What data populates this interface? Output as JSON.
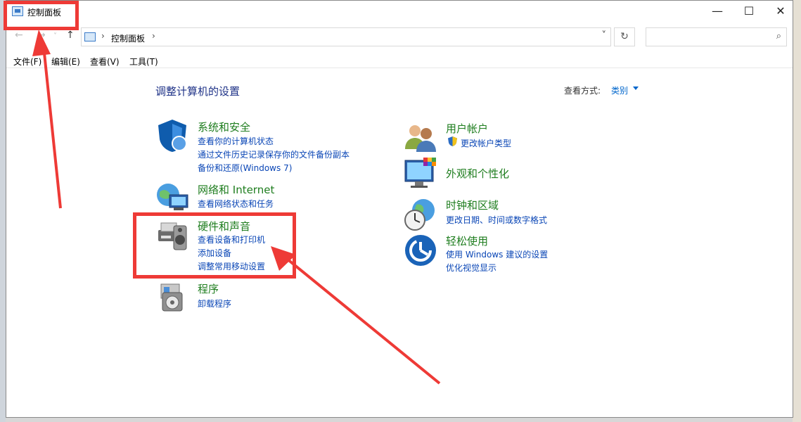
{
  "window": {
    "title": "控制面板",
    "minimize": "—",
    "maximize": "☐",
    "close": "✕"
  },
  "nav": {
    "back": "←",
    "forward": "→",
    "recent": "˅",
    "up": "↑",
    "address_sep": "›",
    "address": "控制面板",
    "address_dropdown": "˅",
    "refresh": "↻",
    "search_placeholder": "",
    "search_glyph": "⌕"
  },
  "menu": [
    "文件(F)",
    "编辑(E)",
    "查看(V)",
    "工具(T)"
  ],
  "heading": "调整计算机的设置",
  "view_by": {
    "label": "查看方式:",
    "value": "类别"
  },
  "categories": {
    "system": {
      "title": "系统和安全",
      "links": [
        "查看你的计算机状态",
        "通过文件历史记录保存你的文件备份副本",
        "备份和还原(Windows 7)"
      ]
    },
    "network": {
      "title": "网络和 Internet",
      "links": [
        "查看网络状态和任务"
      ]
    },
    "hardware": {
      "title": "硬件和声音",
      "links": [
        "查看设备和打印机",
        "添加设备",
        "调整常用移动设置"
      ]
    },
    "programs": {
      "title": "程序",
      "links": [
        "卸载程序"
      ]
    },
    "users": {
      "title": "用户帐户",
      "links": [
        "更改帐户类型"
      ]
    },
    "appearance": {
      "title": "外观和个性化",
      "links": []
    },
    "clock": {
      "title": "时钟和区域",
      "links": [
        "更改日期、时间或数字格式"
      ]
    },
    "ease": {
      "title": "轻松使用",
      "links": [
        "使用 Windows 建议的设置",
        "优化视觉显示"
      ]
    }
  },
  "colors": {
    "annotation": "#ee3a36",
    "category_title": "#1e7d1e",
    "link": "#0a46b6",
    "heading": "#1e3287"
  }
}
